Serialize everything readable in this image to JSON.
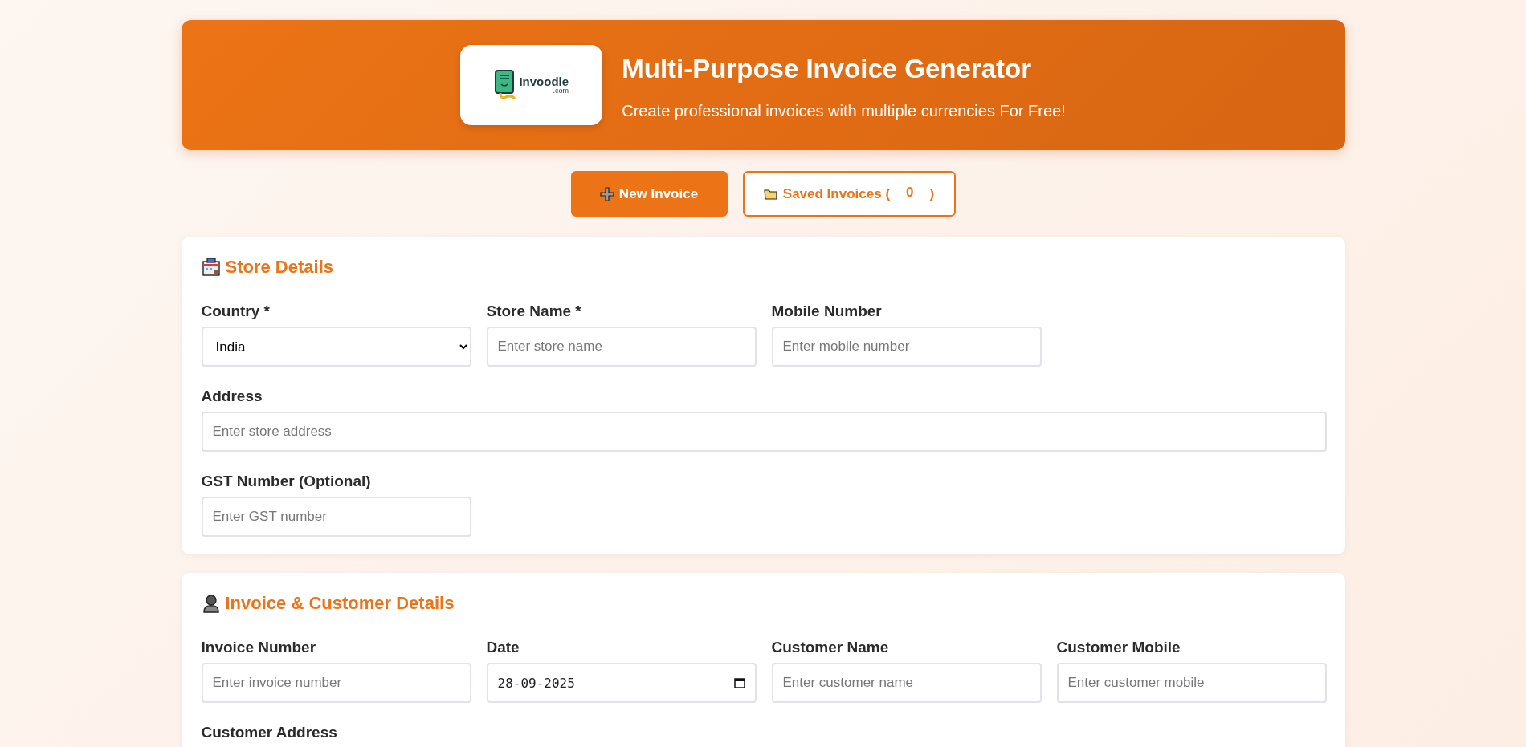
{
  "header": {
    "logo_text": "Invoodle",
    "logo_subtext": ".com",
    "title": "Multi-Purpose Invoice Generator",
    "subtitle": "Create professional invoices with multiple currencies For Free!"
  },
  "actions": [
    {
      "kind": "primary",
      "label": "New Invoice"
    },
    {
      "kind": "outline",
      "label": "Saved Invoices (",
      "count": "0",
      "suffix": ")"
    }
  ],
  "sections": [
    {
      "kind": "store",
      "title": "Store Details",
      "fields": [
        {
          "label": "Country *",
          "kind": "select",
          "value": "India"
        },
        {
          "label": "Store Name *",
          "kind": "text",
          "placeholder": "Enter store name"
        },
        {
          "label": "Mobile Number",
          "kind": "text",
          "placeholder": "Enter mobile number"
        },
        {
          "label": "Address",
          "kind": "text_wide",
          "placeholder": "Enter store address"
        },
        {
          "label": "GST Number (Optional)",
          "kind": "text",
          "placeholder": "Enter GST number"
        }
      ]
    },
    {
      "kind": "customer",
      "title": "Invoice & Customer Details",
      "fields": [
        {
          "label": "Invoice Number",
          "kind": "text",
          "placeholder": "Enter invoice number"
        },
        {
          "label": "Date",
          "kind": "date",
          "value": "28-09-2025"
        },
        {
          "label": "Customer Name",
          "kind": "text",
          "placeholder": "Enter customer name"
        },
        {
          "label": "Customer Mobile",
          "kind": "text",
          "placeholder": "Enter customer mobile"
        },
        {
          "label": "Customer Address"
        }
      ]
    }
  ]
}
